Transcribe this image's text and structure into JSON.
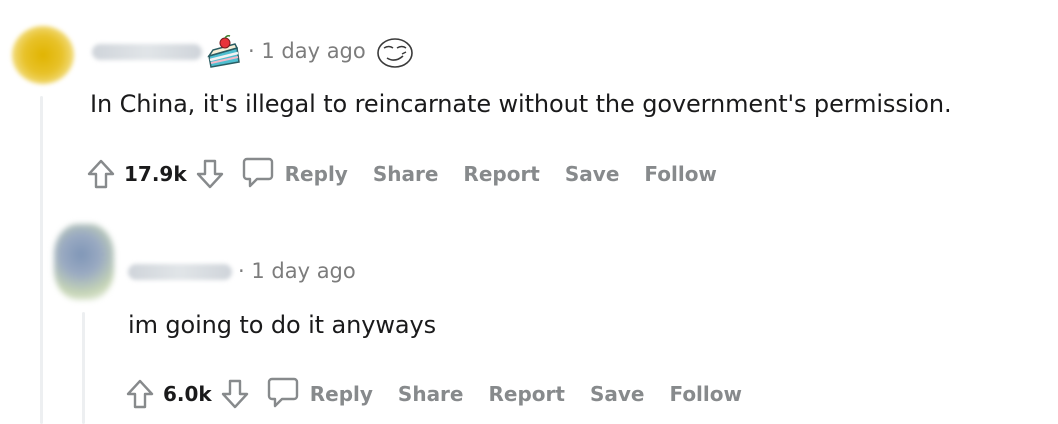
{
  "comments": [
    {
      "timestamp": "· 1 day ago",
      "text": "In China, it's illegal to reincarnate without the government's permission.",
      "score": "17.9k",
      "actions": {
        "reply": "Reply",
        "share": "Share",
        "report": "Report",
        "save": "Save",
        "follow": "Follow"
      },
      "badges": [
        "cake-icon",
        "award-smirk-icon"
      ]
    },
    {
      "timestamp": "· 1 day ago",
      "text": "im going to do it anyways",
      "score": "6.0k",
      "actions": {
        "reply": "Reply",
        "share": "Share",
        "report": "Report",
        "save": "Save",
        "follow": "Follow"
      }
    }
  ],
  "colors": {
    "text": "#1a1a1b",
    "meta": "#7c7c7c",
    "action": "#878a8c",
    "thread_line": "#edeff1"
  }
}
